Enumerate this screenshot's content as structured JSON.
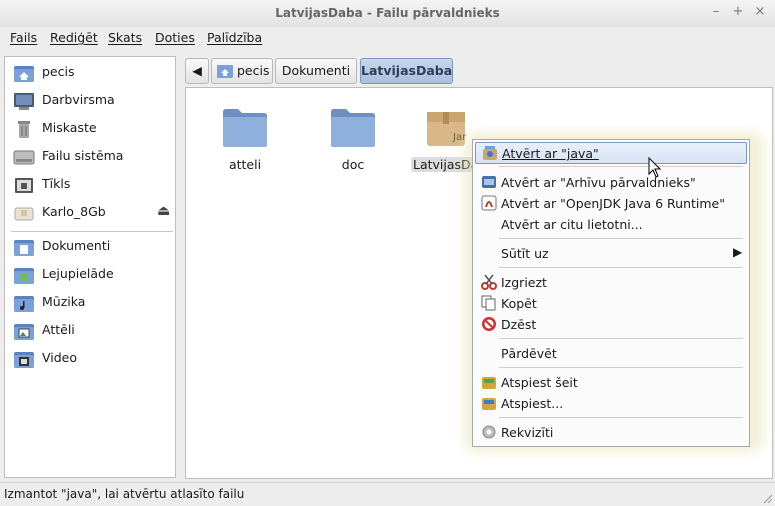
{
  "window": {
    "title": "LatvijasDaba - Failu pārvaldnieks",
    "minimize": "–",
    "maximize": "+",
    "close": "×"
  },
  "menubar": {
    "items": [
      "Fails",
      "Rediģēt",
      "Skats",
      "Doties",
      "Palīdzība"
    ]
  },
  "sidebar": {
    "places": [
      {
        "label": "pecis",
        "icon": "home-folder-icon"
      },
      {
        "label": "Darbvirsma",
        "icon": "desktop-icon"
      },
      {
        "label": "Miskaste",
        "icon": "trash-icon"
      },
      {
        "label": "Failu sistēma",
        "icon": "harddisk-icon"
      },
      {
        "label": "Tīkls",
        "icon": "network-icon"
      },
      {
        "label": "Karlo_8Gb",
        "icon": "usb-drive-icon",
        "eject": "⏏"
      }
    ],
    "bookmarks": [
      {
        "label": "Dokumenti",
        "icon": "documents-folder-icon"
      },
      {
        "label": "Lejupielāde",
        "icon": "downloads-folder-icon"
      },
      {
        "label": "Mūzika",
        "icon": "music-folder-icon"
      },
      {
        "label": "Attēli",
        "icon": "pictures-folder-icon"
      },
      {
        "label": "Video",
        "icon": "video-folder-icon"
      }
    ]
  },
  "pathbar": {
    "back": "◀",
    "crumbs": [
      "pecis",
      "Dokumenti",
      "LatvijasDaba"
    ]
  },
  "files": [
    {
      "name": "atteli",
      "icon": "folder-icon"
    },
    {
      "name": "doc",
      "icon": "folder-icon"
    },
    {
      "name": "LatvijasDaba",
      "icon": "jar-archive-icon",
      "badge": "Jar"
    }
  ],
  "context_menu": {
    "items": [
      {
        "label": "Atvērt ar \"java\"",
        "icon": "java-icon",
        "highlight": true
      },
      {
        "label": "Atvērt ar \"Arhīvu pārvaldnieks\"",
        "icon": "archive-manager-icon"
      },
      {
        "label": "Atvērt ar \"OpenJDK Java 6 Runtime\"",
        "icon": "openjdk-icon"
      },
      {
        "label": "Atvērt ar citu lietotni...",
        "icon": ""
      },
      {
        "label": "Sūtīt uz",
        "icon": "",
        "submenu": "▶"
      },
      {
        "label": "Izgriezt",
        "icon": "scissors-icon"
      },
      {
        "label": "Kopēt",
        "icon": "copy-icon"
      },
      {
        "label": "Dzēst",
        "icon": "delete-icon"
      },
      {
        "label": "Pārdēvēt",
        "icon": ""
      },
      {
        "label": "Atspiest šeit",
        "icon": "extract-here-icon"
      },
      {
        "label": "Atspiest...",
        "icon": "extract-icon"
      },
      {
        "label": "Rekvizīti",
        "icon": "properties-gear-icon"
      }
    ]
  },
  "statusbar": {
    "text": "Izmantot \"java\", lai atvērtu atlasīto failu"
  }
}
